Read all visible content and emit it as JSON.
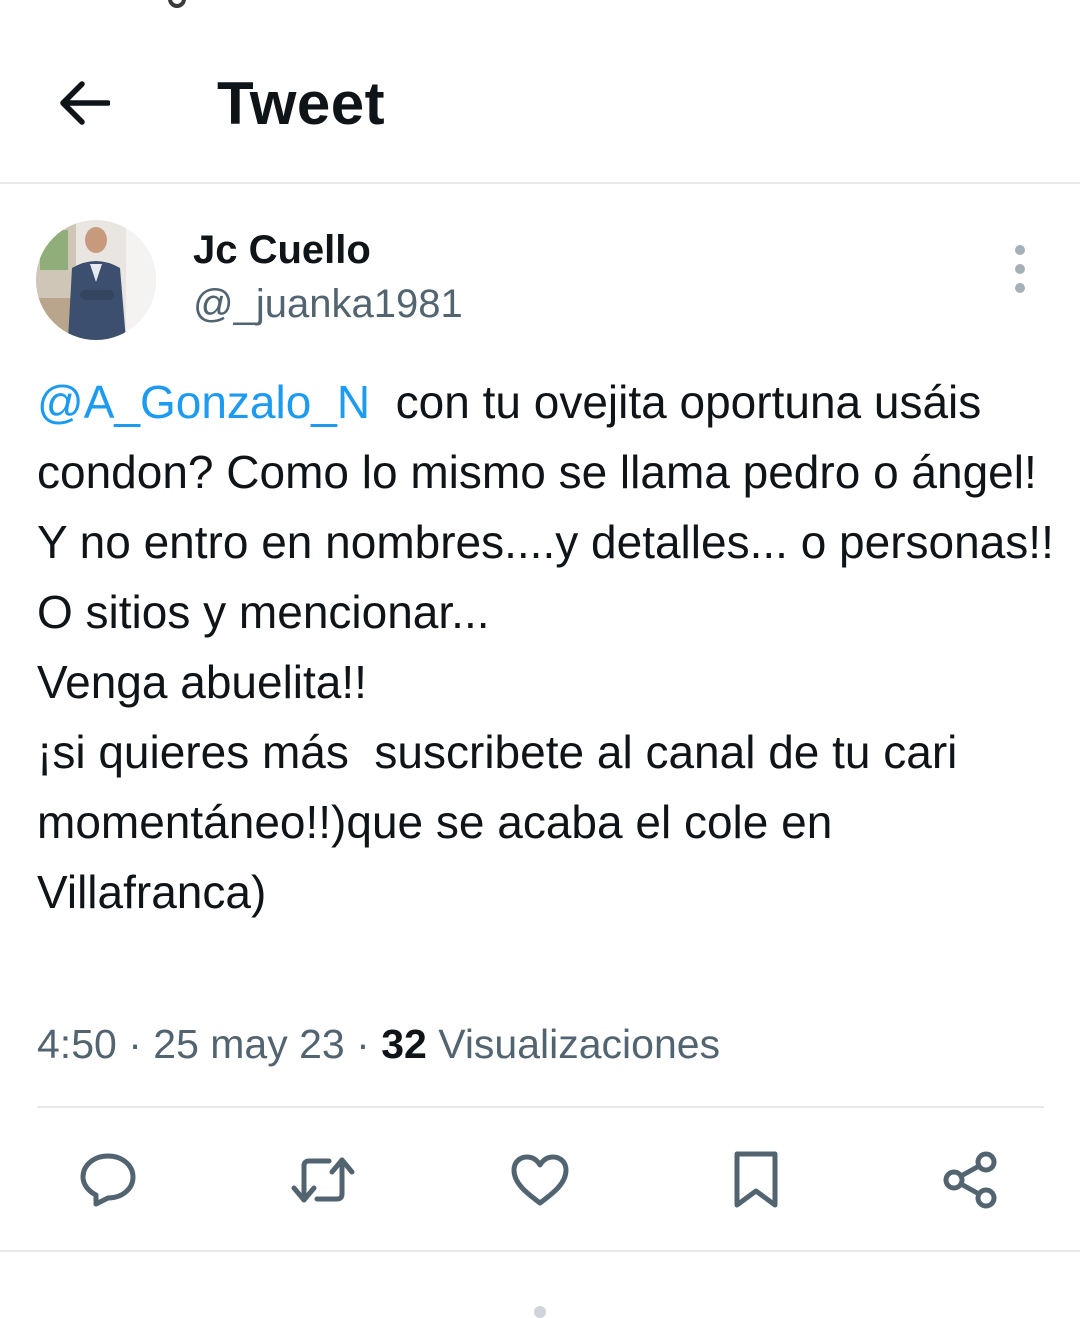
{
  "header": {
    "title": "Tweet",
    "back_icon": "arrow-left-icon"
  },
  "tweet": {
    "author": {
      "display_name": "Jc Cuello",
      "handle": "@_juanka1981",
      "avatar": "profile-photo"
    },
    "mention": "@A_Gonzalo_N",
    "text": "  con tu ovejita oportuna usáis condon? Como lo mismo se llama pedro o ángel!\nY no entro en nombres....y detalles... o personas!! O sitios y mencionar...\nVenga abuelita!!\n¡si quieres más  suscribete al canal de tu cari momentáneo!!)que se acaba el cole en Villafranca)",
    "time": "4:50",
    "separator": "·",
    "date": "25 may 23",
    "views_count": "32",
    "views_label": "Visualizaciones"
  },
  "actions": [
    {
      "icon": "reply-icon"
    },
    {
      "icon": "retweet-icon"
    },
    {
      "icon": "like-heart-icon"
    },
    {
      "icon": "bookmark-icon"
    },
    {
      "icon": "share-icon"
    }
  ],
  "colors": {
    "text": "#0f1419",
    "secondary": "#536471",
    "link": "#1d9bf0",
    "icon": "#536471",
    "divider": "#e6e8ea"
  }
}
